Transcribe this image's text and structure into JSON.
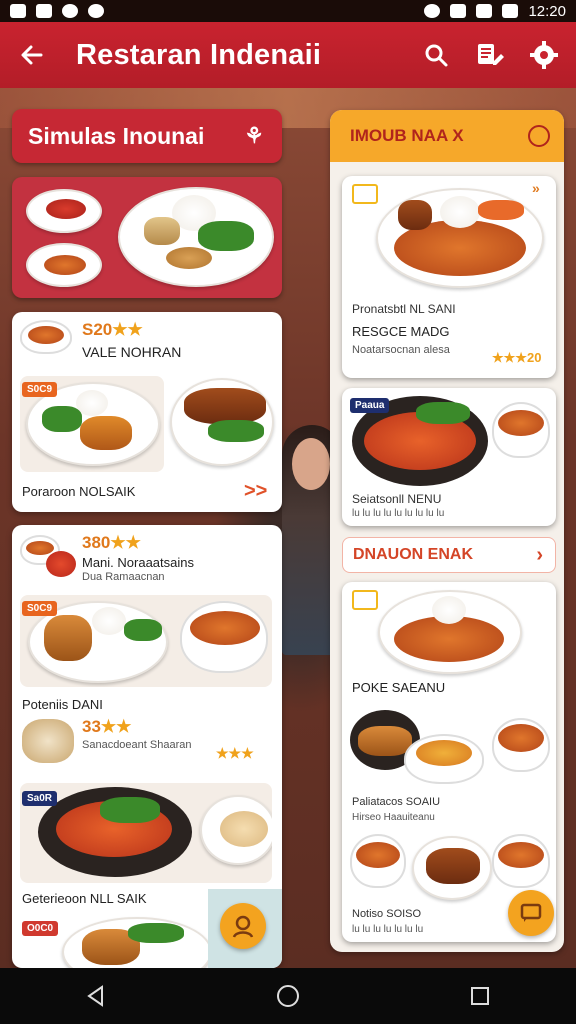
{
  "status": {
    "time": "12:20"
  },
  "appbar": {
    "title": "Restaran Indenaii"
  },
  "left": {
    "header": "Simulas Inounai",
    "card1": {
      "price": "S20",
      "stars": "★★",
      "name": "VALE NOHRAN",
      "footer": "Poraroon NOLSAIK",
      "tag": ""
    },
    "card2": {
      "price": "380",
      "stars": "★★",
      "name": "Mani. Noraaatsains",
      "sub": "Dua Ramaacnan",
      "section_label": "Poteniis DANI",
      "price2": "33",
      "stars2": "★★",
      "sub2": "Sanacdoeant Shaaran",
      "stars3": "★★★",
      "tag_a": "S0C9",
      "tag_b": "Sa0R",
      "footer": "Geterieoon NLL SAIK",
      "tag_c": "O0C0"
    }
  },
  "right": {
    "header": "IMOUB NAA X",
    "card1": {
      "title": "Pronatsbtl NL SANI",
      "subtitle": "RESGCE MADG",
      "small": "Noatarsocnan alesa",
      "rating": "★★★20"
    },
    "card2": {
      "tag": "Paaua",
      "title": "Seiatsonll NENU",
      "small": "lu lu lu lu lu lu lu lu lu"
    },
    "link": "DNAUON ENAK",
    "card3": {
      "title": "POKE SAEANU",
      "label2": "Paliatacos SOAIU",
      "small2": "Hirseo Haauiteanu",
      "label3": "Notiso SOISO",
      "small3": "lu lu lu lu lu lu lu"
    }
  },
  "icons": [
    "back-arrow-icon",
    "search-icon",
    "list-edit-icon",
    "gear-icon",
    "user-icon",
    "chevron-right-icon",
    "chat-icon",
    "home-icon",
    "recents-icon"
  ]
}
